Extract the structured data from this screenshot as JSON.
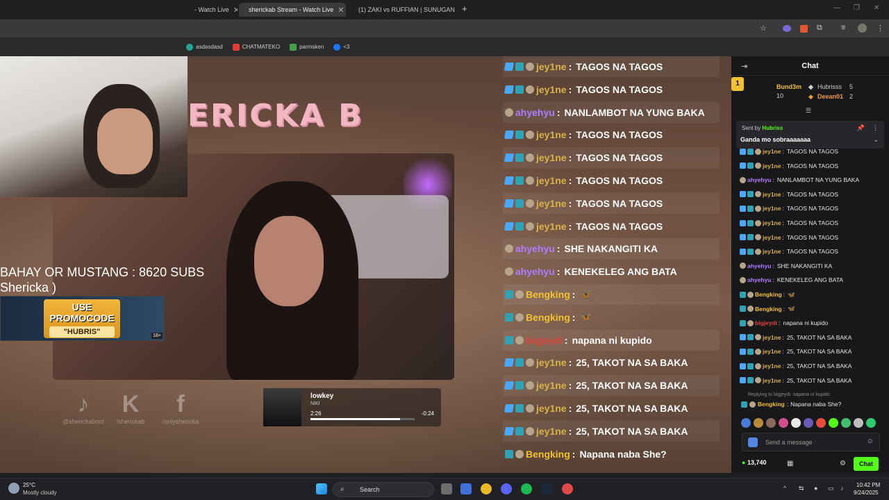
{
  "browser": {
    "tabs": [
      {
        "label": "- Watch Live",
        "active": false
      },
      {
        "label": "sherickab Stream - Watch Live",
        "active": true
      },
      {
        "label": "(1) ZAKI vs RUFFIAN | SUNUGAN",
        "active": false
      }
    ],
    "new_tab": "+",
    "bookmarks": [
      "asdasdasd",
      "CHATMATEKO",
      "parmsken",
      "<3"
    ]
  },
  "stream": {
    "logo_text": "ERICKA B",
    "sub_goal_line1": "BAHAY OR MUSTANG : 8620 SUBS",
    "sub_goal_line2": "Shericka )",
    "promo_line1": "USE PROMOCODE",
    "promo_line2": "\"HUBRIS\"",
    "promo_age": "18+",
    "socials": [
      {
        "icon": "tiktok-icon",
        "glyph": "♪",
        "handle": "@sherickabool"
      },
      {
        "icon": "kick-icon",
        "glyph": "K",
        "handle": "/sherickab"
      },
      {
        "icon": "facebook-icon",
        "glyph": "f",
        "handle": "/onlyshericka"
      }
    ],
    "music": {
      "title": "lowkey",
      "artist": "NIKI",
      "elapsed": "2:26",
      "remaining": "-0:24",
      "progress": 0.86
    }
  },
  "overlay_chat": [
    {
      "user": "jey1ne",
      "color": "#d8b24a",
      "badges": [
        "sword",
        "grid",
        "round"
      ],
      "text": "TAGOS NA TAGOS"
    },
    {
      "user": "jey1ne",
      "color": "#d8b24a",
      "badges": [
        "sword",
        "grid",
        "round"
      ],
      "text": "TAGOS NA TAGOS"
    },
    {
      "user": "ahyehyu",
      "color": "#b07cff",
      "badges": [
        "round"
      ],
      "text": "NANLAMBOT NA YUNG BAKA"
    },
    {
      "user": "jey1ne",
      "color": "#d8b24a",
      "badges": [
        "sword",
        "grid",
        "round"
      ],
      "text": "TAGOS NA TAGOS"
    },
    {
      "user": "jey1ne",
      "color": "#d8b24a",
      "badges": [
        "sword",
        "grid",
        "round"
      ],
      "text": "TAGOS NA TAGOS"
    },
    {
      "user": "jey1ne",
      "color": "#d8b24a",
      "badges": [
        "sword",
        "grid",
        "round"
      ],
      "text": "TAGOS NA TAGOS"
    },
    {
      "user": "jey1ne",
      "color": "#d8b24a",
      "badges": [
        "sword",
        "grid",
        "round"
      ],
      "text": "TAGOS NA TAGOS"
    },
    {
      "user": "jey1ne",
      "color": "#d8b24a",
      "badges": [
        "sword",
        "grid",
        "round"
      ],
      "text": "TAGOS NA TAGOS"
    },
    {
      "user": "ahyehyu",
      "color": "#b07cff",
      "badges": [
        "round"
      ],
      "text": "SHE NAKANGITI KA"
    },
    {
      "user": "ahyehyu",
      "color": "#b07cff",
      "badges": [
        "round"
      ],
      "text": "KENEKELEG ANG BATA"
    },
    {
      "user": "Bengking",
      "color": "#f2c230",
      "badges": [
        "grid",
        "round"
      ],
      "text": "🦋"
    },
    {
      "user": "Bengking",
      "color": "#f2c230",
      "badges": [
        "grid",
        "round"
      ],
      "text": "🦋"
    },
    {
      "user": "bigjeydi",
      "color": "#e0443c",
      "badges": [
        "grid",
        "round"
      ],
      "text": "napana ni kupido"
    },
    {
      "user": "jey1ne",
      "color": "#d8b24a",
      "badges": [
        "sword",
        "grid",
        "round"
      ],
      "text": "25, TAKOT NA SA BAKA"
    },
    {
      "user": "jey1ne",
      "color": "#d8b24a",
      "badges": [
        "sword",
        "grid",
        "round"
      ],
      "text": "25, TAKOT NA SA BAKA"
    },
    {
      "user": "jey1ne",
      "color": "#d8b24a",
      "badges": [
        "sword",
        "grid",
        "round"
      ],
      "text": "25, TAKOT NA SA BAKA"
    },
    {
      "user": "jey1ne",
      "color": "#d8b24a",
      "badges": [
        "sword",
        "grid",
        "round"
      ],
      "text": "25, TAKOT NA SA BAKA"
    },
    {
      "user": "Bengking",
      "color": "#f2c230",
      "badges": [
        "grid",
        "round"
      ],
      "text": "Napana naba She?"
    }
  ],
  "panel": {
    "title": "Chat",
    "leaderboard": [
      {
        "rank": "1",
        "name": "Bund3m",
        "count": "10",
        "color": "#f2c230"
      },
      {
        "name": "Hubrisss",
        "count": "5",
        "color": "#cfcfcf"
      },
      {
        "name": "Deean01",
        "count": "2",
        "color": "#f09c3a"
      }
    ],
    "pinned": {
      "sent_by_label": "Sent by",
      "sender": "Hubriss",
      "text": "Ganda mo sobraaaaaaa"
    },
    "messages": [
      {
        "user": "jey1ne",
        "color": "#d8b24a",
        "badges": [
          "sword",
          "grid",
          "round"
        ],
        "text": "TAGOS NA TAGOS"
      },
      {
        "user": "jey1ne",
        "color": "#d8b24a",
        "badges": [
          "sword",
          "grid",
          "round"
        ],
        "text": "TAGOS NA TAGOS"
      },
      {
        "user": "ahyehyu",
        "color": "#b07cff",
        "badges": [
          "round"
        ],
        "text": "NANLAMBOT NA YUNG BAKA"
      },
      {
        "user": "jey1ne",
        "color": "#d8b24a",
        "badges": [
          "sword",
          "grid",
          "round"
        ],
        "text": "TAGOS NA TAGOS"
      },
      {
        "user": "jey1ne",
        "color": "#d8b24a",
        "badges": [
          "sword",
          "grid",
          "round"
        ],
        "text": "TAGOS NA TAGOS"
      },
      {
        "user": "jey1ne",
        "color": "#d8b24a",
        "badges": [
          "sword",
          "grid",
          "round"
        ],
        "text": "TAGOS NA TAGOS"
      },
      {
        "user": "jey1ne",
        "color": "#d8b24a",
        "badges": [
          "sword",
          "grid",
          "round"
        ],
        "text": "TAGOS NA TAGOS"
      },
      {
        "user": "jey1ne",
        "color": "#d8b24a",
        "badges": [
          "sword",
          "grid",
          "round"
        ],
        "text": "TAGOS NA TAGOS"
      },
      {
        "user": "ahyehyu",
        "color": "#b07cff",
        "badges": [
          "round"
        ],
        "text": "SHE NAKANGITI KA"
      },
      {
        "user": "ahyehyu",
        "color": "#b07cff",
        "badges": [
          "round"
        ],
        "text": "KENEKELEG ANG BATA"
      },
      {
        "user": "Bengking",
        "color": "#f2c230",
        "badges": [
          "grid",
          "round"
        ],
        "text": "🦋"
      },
      {
        "user": "Bengking",
        "color": "#f2c230",
        "badges": [
          "grid",
          "round"
        ],
        "text": "🦋"
      },
      {
        "user": "bigjeydi",
        "color": "#e0443c",
        "badges": [
          "grid",
          "round"
        ],
        "text": "napana ni kupido"
      },
      {
        "user": "jey1ne",
        "color": "#d8b24a",
        "badges": [
          "sword",
          "grid",
          "round"
        ],
        "text": "25, TAKOT NA SA BAKA"
      },
      {
        "user": "jey1ne",
        "color": "#d8b24a",
        "badges": [
          "sword",
          "grid",
          "round"
        ],
        "text": "25, TAKOT NA SA BAKA"
      },
      {
        "user": "jey1ne",
        "color": "#d8b24a",
        "badges": [
          "sword",
          "grid",
          "round"
        ],
        "text": "25, TAKOT NA SA BAKA"
      },
      {
        "user": "jey1ne",
        "color": "#d8b24a",
        "badges": [
          "sword",
          "grid",
          "round"
        ],
        "text": "25, TAKOT NA SA BAKA"
      }
    ],
    "reply_context": "Replying to bigjeydi: napana ni kupido",
    "reply": {
      "user": "Bengking",
      "color": "#f2c230",
      "text": "Napana naba She?"
    },
    "input_placeholder": "Send a message",
    "points": "13,740",
    "chat_button": "Chat",
    "accent": "#53fc18"
  },
  "taskbar": {
    "temperature": "25°C",
    "weather": "Mostly cloudy",
    "search_label": "Search",
    "time": "10:42 PM",
    "date": "9/24/2025"
  }
}
